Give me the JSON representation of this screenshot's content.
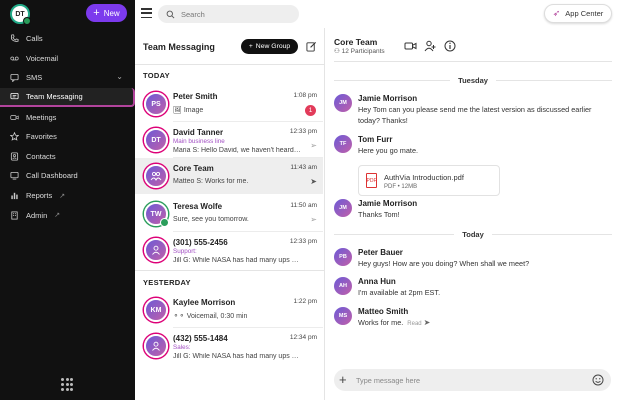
{
  "sidebar": {
    "user_initials": "DT",
    "new_label": "New",
    "items": [
      {
        "label": "Calls",
        "icon": "phone-icon"
      },
      {
        "label": "Voicemail",
        "icon": "voicemail-icon"
      },
      {
        "label": "SMS",
        "icon": "chat-icon"
      },
      {
        "label": "Team Messaging",
        "icon": "team-chat-icon"
      },
      {
        "label": "Meetings",
        "icon": "video-icon"
      },
      {
        "label": "Favorites",
        "icon": "star-icon"
      },
      {
        "label": "Contacts",
        "icon": "contacts-icon"
      },
      {
        "label": "Call Dashboard",
        "icon": "dashboard-icon"
      },
      {
        "label": "Reports",
        "icon": "bar-chart-icon"
      },
      {
        "label": "Admin",
        "icon": "building-icon"
      }
    ]
  },
  "topbar": {
    "search_placeholder": "Search",
    "app_center_label": "App Center"
  },
  "messaging": {
    "title": "Team Messaging",
    "new_group_label": "New Group",
    "today_label": "TODAY",
    "yesterday_label": "YESTERDAY",
    "conversations": [
      {
        "initials": "PS",
        "name": "Peter Smith",
        "time": "1:08 pm",
        "line": "Image",
        "badge": "1"
      },
      {
        "initials": "DT",
        "name": "David Tanner",
        "time": "12:33 pm",
        "sub": "Main business line",
        "line": "Maria S: Hello David, we haven't heard back from you"
      },
      {
        "initials": "",
        "name": "Core Team",
        "time": "11:43 am",
        "line": "Matteo S: Works for me."
      },
      {
        "initials": "TW",
        "name": "Teresa Wolfe",
        "time": "11:50 am",
        "line": "Sure, see you tomorrow."
      },
      {
        "initials": "",
        "name": "(301) 555-2456",
        "time": "12:33 pm",
        "sub": "Support:",
        "line": "Jill G: While NASA has had many ups and downs"
      },
      {
        "initials": "KM",
        "name": "Kaylee Morrison",
        "time": "1:22 pm",
        "line": "Voicemail, 0:30 min"
      },
      {
        "initials": "",
        "name": "(432) 555-1484",
        "time": "12:34 pm",
        "sub": "Sales:",
        "line": "Jill G: While NASA has had many ups and downs"
      }
    ]
  },
  "chat": {
    "title": "Core Team",
    "participants": "12 Participants",
    "day1": "Tuesday",
    "day2": "Today",
    "messages": [
      {
        "initials": "JM",
        "name": "Jamie Morrison",
        "text": "Hey Tom can you please send me the latest version as discussed earlier today? Thanks!"
      },
      {
        "initials": "TF",
        "name": "Tom Furr",
        "text": "Here you go mate."
      },
      {
        "initials": "JM",
        "name": "Jamie Morrison",
        "text": "Thanks Tom!"
      },
      {
        "initials": "PB",
        "name": "Peter Bauer",
        "text": "Hey guys! How are you doing? When shall we meet?"
      },
      {
        "initials": "AH",
        "name": "Anna Hun",
        "text": "I'm available at 2pm EST."
      },
      {
        "initials": "MS",
        "name": "Matteo Smith",
        "text": "Works for me.",
        "status": "Read"
      }
    ],
    "file": {
      "name": "AuthVia Introduction.pdf",
      "meta": "PDF • 12MB"
    },
    "composer_placeholder": "Type message here"
  }
}
